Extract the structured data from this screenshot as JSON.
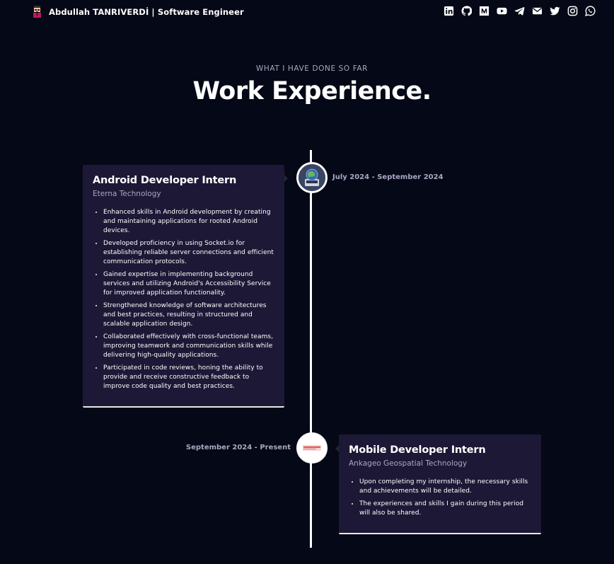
{
  "nav": {
    "brand": "Abdullah TANRIVERDİ  | Software Engineer",
    "socials": [
      {
        "icon": "linkedin-icon"
      },
      {
        "icon": "github-icon"
      },
      {
        "icon": "medium-icon"
      },
      {
        "icon": "youtube-icon"
      },
      {
        "icon": "telegram-icon"
      },
      {
        "icon": "email-icon"
      },
      {
        "icon": "twitter-icon"
      },
      {
        "icon": "instagram-icon"
      },
      {
        "icon": "whatsapp-icon"
      }
    ]
  },
  "header": {
    "subtitle": "WHAT I HAVE DONE SO FAR",
    "title": "Work Experience."
  },
  "colors": {
    "background": "#050816",
    "card": "#1d1836",
    "secondary_text": "#aaa6c3",
    "timeline": "#ffffff"
  },
  "experiences": [
    {
      "title": "Android Developer Intern",
      "company": "Eterna Technology",
      "date": "July 2024 - September 2024",
      "icon": "eterna-logo-icon",
      "points": [
        "Enhanced skills in Android development by creating and maintaining applications for rooted Android devices.",
        "Developed proficiency in using Socket.io for establishing reliable server connections and efficient communication protocols.",
        "Gained expertise in implementing background services and utilizing Android's Accessibility Service for improved application functionality.",
        "Strengthened knowledge of software architectures and best practices, resulting in structured and scalable application design.",
        "Collaborated effectively with cross-functional teams, improving teamwork and communication skills while delivering high-quality applications.",
        "Participated in code reviews, honing the ability to provide and receive constructive feedback to improve code quality and best practices."
      ]
    },
    {
      "title": "Mobile Developer Intern",
      "company": "Ankageo Geospatial Technology",
      "date": "September 2024 - Present",
      "icon": "ankageo-logo-icon",
      "points": [
        "Upon completing my internship, the necessary skills and achievements will be detailed.",
        "The experiences and skills I gain during this period will also be shared."
      ]
    }
  ]
}
